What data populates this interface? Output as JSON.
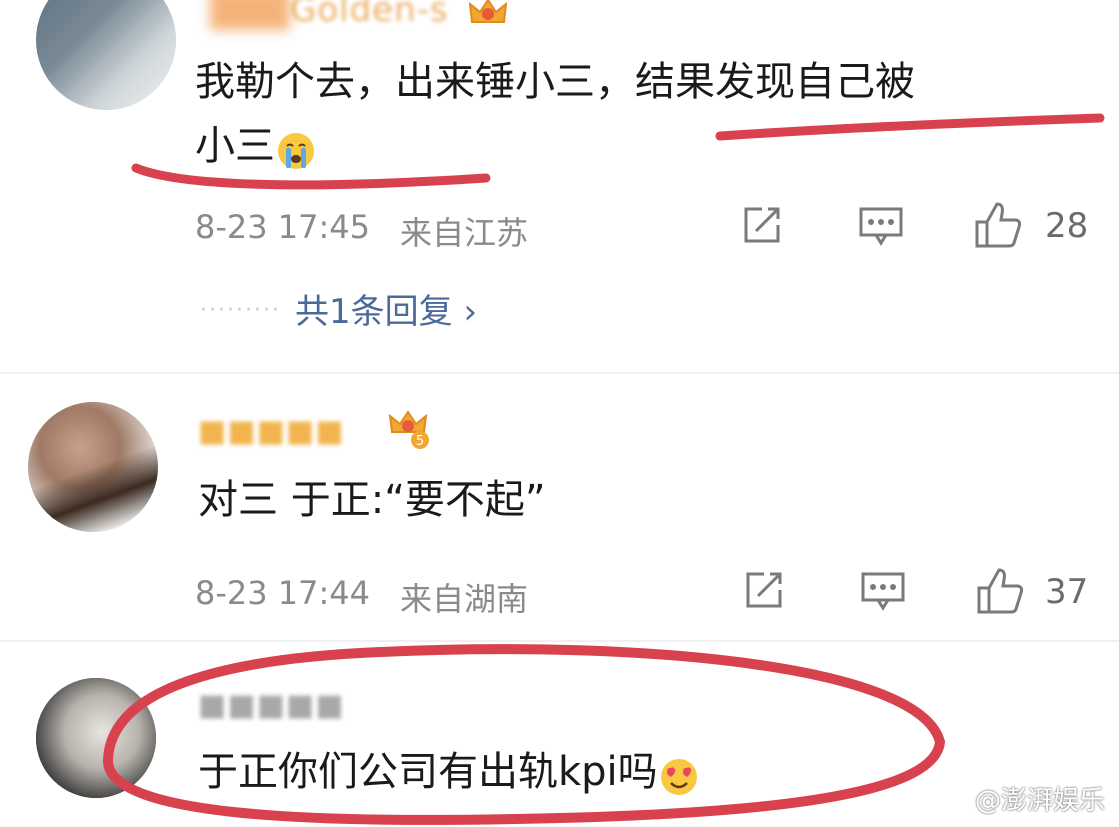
{
  "comments": [
    {
      "username": "Golden-s",
      "text_line1": "我勒个去，出来锤小三，结果发现自己被",
      "text_line2": "小三",
      "emoji": "crying-face-icon",
      "timestamp": "8-23 17:45",
      "location": "来自江苏",
      "likes": "28",
      "reply_link": "共1条回复 ›"
    },
    {
      "username": "■■■■■",
      "text": "对三 于正:“要不起”",
      "timestamp": "8-23 17:44",
      "location": "来自湖南",
      "likes": "37"
    },
    {
      "username": "■■■■■",
      "text": "于正你们公司有出轨kpi吗",
      "emoji": "heart-eyes-icon"
    }
  ],
  "watermark": "@澎湃娱乐",
  "colors": {
    "annotation_red": "#d7424e",
    "badge_gold": "#f0a830"
  }
}
